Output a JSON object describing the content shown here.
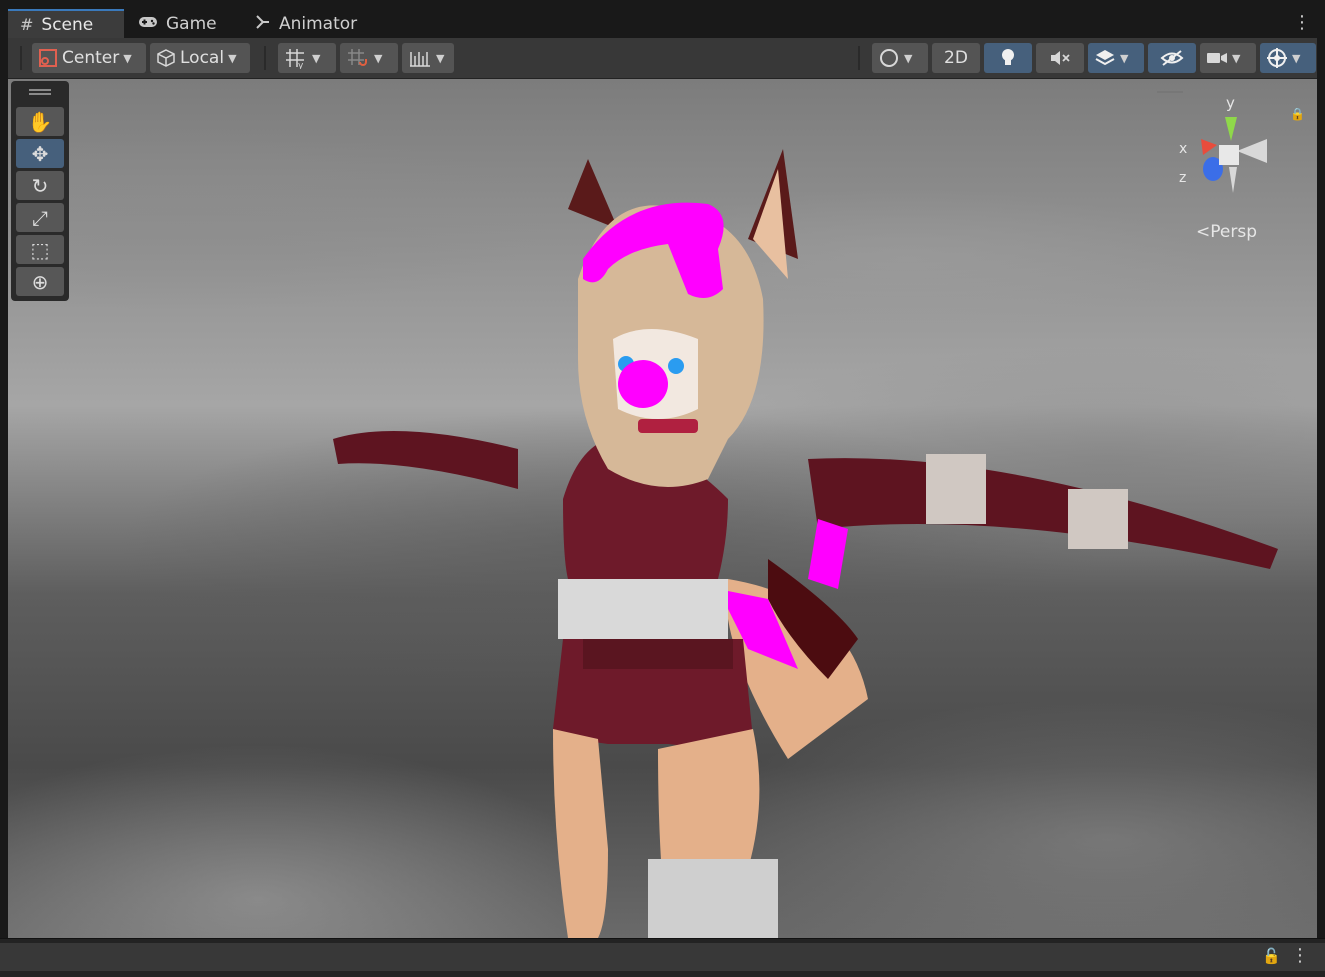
{
  "tabs": [
    {
      "label": "Scene",
      "icon": "grid-icon"
    },
    {
      "label": "Game",
      "icon": "gamepad-icon"
    },
    {
      "label": "Animator",
      "icon": "animator-icon"
    }
  ],
  "toolbar": {
    "pivot_label": "Center",
    "space_label": "Local",
    "mode_2d_label": "2D"
  },
  "tools": [
    "hand-tool",
    "move-tool",
    "rotate-tool",
    "scale-tool",
    "rect-tool",
    "transform-tool"
  ],
  "gizmo": {
    "x": "x",
    "y": "y",
    "z": "z",
    "projection_label": "Persp"
  },
  "colors": {
    "accent": "#46607c",
    "active_tab_border": "#3a79bb",
    "missing_material": "#ff00ff"
  }
}
